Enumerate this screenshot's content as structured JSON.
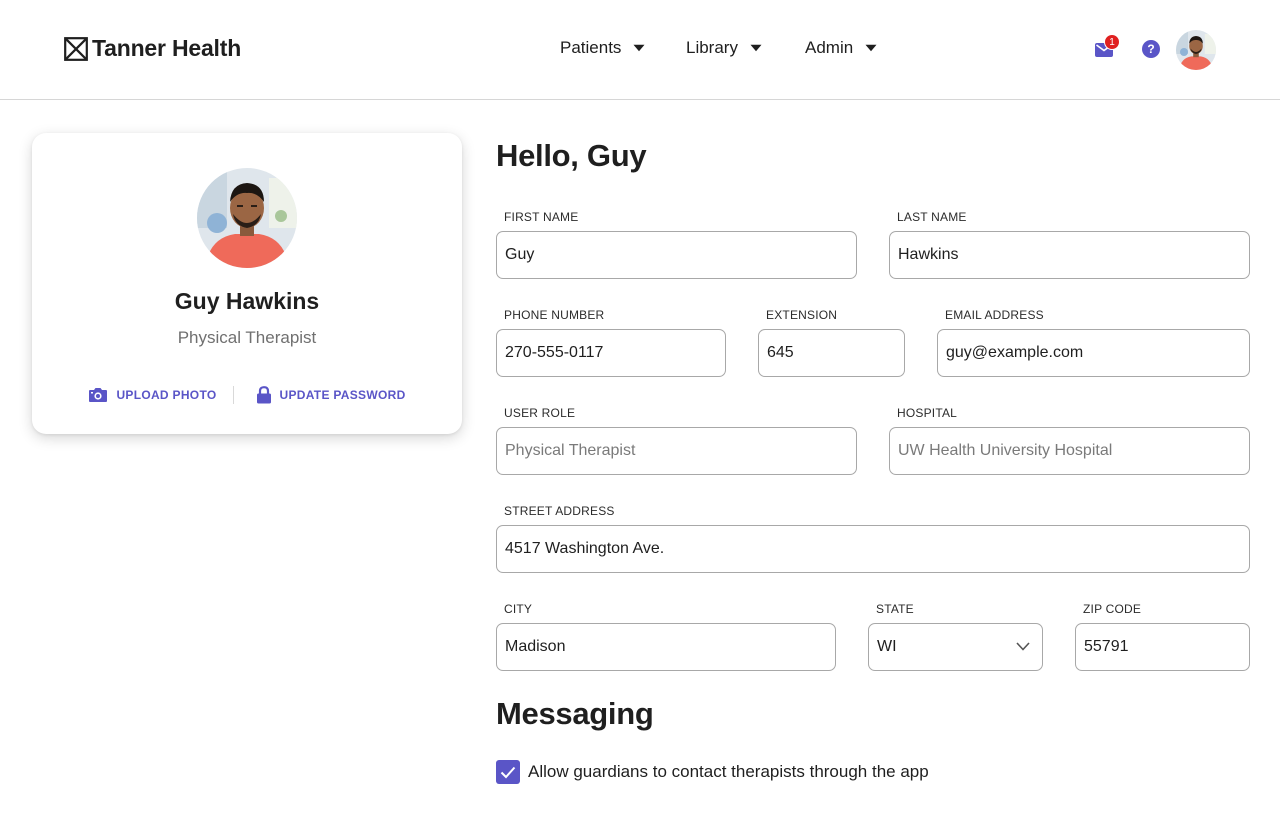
{
  "brand": {
    "name": "Tanner Health",
    "logo_icon": "x-box-icon"
  },
  "nav": {
    "items": [
      {
        "label": "Patients",
        "icon": "caret-down-icon"
      },
      {
        "label": "Library",
        "icon": "caret-down-icon"
      },
      {
        "label": "Admin",
        "icon": "caret-down-icon"
      }
    ]
  },
  "header": {
    "mail_icon": "envelope-icon",
    "unread_count": "1",
    "help_glyph": "?",
    "help_icon": "question-circle-icon"
  },
  "profile": {
    "name": "Guy Hawkins",
    "role": "Physical Therapist",
    "upload_photo_label": "UPLOAD PHOTO",
    "upload_photo_icon": "camera-icon",
    "update_password_label": "UPDATE PASSWORD",
    "update_password_icon": "lock-icon"
  },
  "form": {
    "greeting": "Hello, Guy",
    "first_name": {
      "label": "FIRST NAME",
      "value": "Guy"
    },
    "last_name": {
      "label": "LAST NAME",
      "value": "Hawkins"
    },
    "phone": {
      "label": "PHONE NUMBER",
      "value": "270-555-0117"
    },
    "extension": {
      "label": "EXTENSION",
      "value": "645"
    },
    "email": {
      "label": "EMAIL ADDRESS",
      "value": "guy@example.com"
    },
    "user_role": {
      "label": "USER ROLE",
      "value": "Physical Therapist"
    },
    "hospital": {
      "label": "HOSPITAL",
      "value": "UW Health University Hospital"
    },
    "street": {
      "label": "STREET ADDRESS",
      "value": "4517 Washington Ave."
    },
    "city": {
      "label": "CITY",
      "value": "Madison"
    },
    "state": {
      "label": "STATE",
      "value": "WI",
      "icon": "chevron-down-icon"
    },
    "zip": {
      "label": "ZIP CODE",
      "value": "55791"
    }
  },
  "messaging": {
    "title": "Messaging",
    "allow_guardians": {
      "label": "Allow guardians to contact therapists through the app",
      "checked": true
    }
  },
  "colors": {
    "accent": "#5a55c7",
    "badge": "#e02020",
    "border": "#a8a8a8",
    "muted": "#707070"
  }
}
